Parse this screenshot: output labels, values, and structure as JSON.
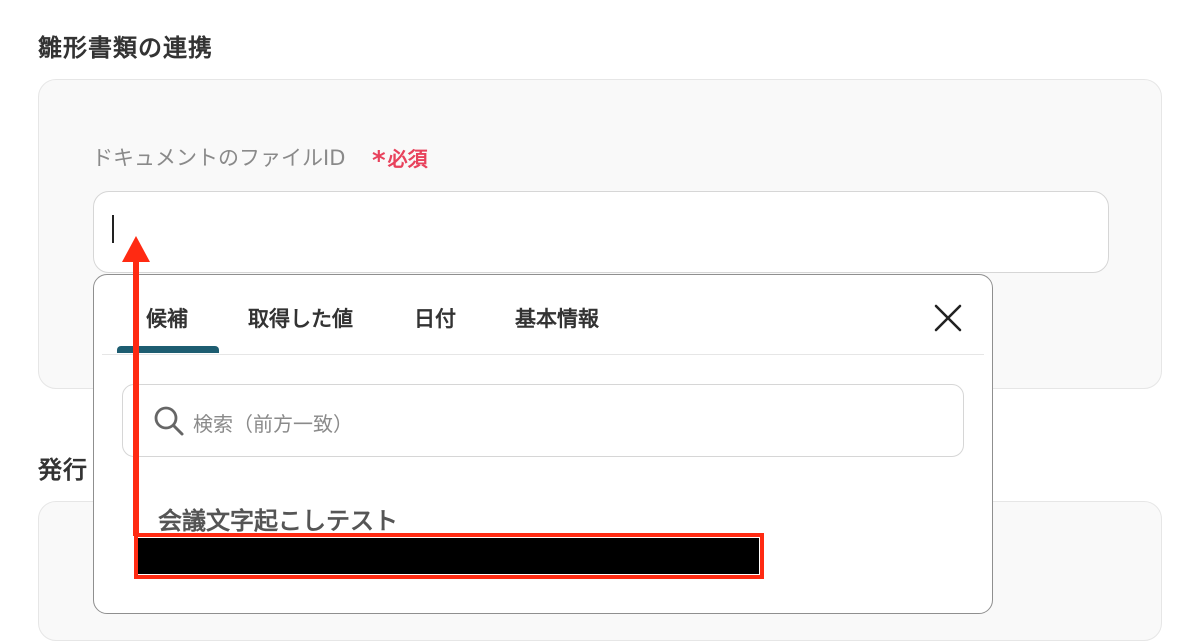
{
  "sections": {
    "title_1": "雛形書類の連携",
    "title_2": "発行"
  },
  "field": {
    "label": "ドキュメントのファイルID",
    "required_star": "*",
    "required_text": "必須",
    "value": ""
  },
  "popup": {
    "tabs": [
      "候補",
      "取得した値",
      "日付",
      "基本情報"
    ],
    "active_tab": "候補",
    "search_placeholder": "検索（前方一致）",
    "group_title": "会議文字起こしテスト"
  },
  "colors": {
    "accent": "#1d5d71",
    "required": "#e8425c",
    "annotation": "#ff2a12"
  },
  "icons": {
    "close": "close-icon",
    "search": "search-icon"
  }
}
